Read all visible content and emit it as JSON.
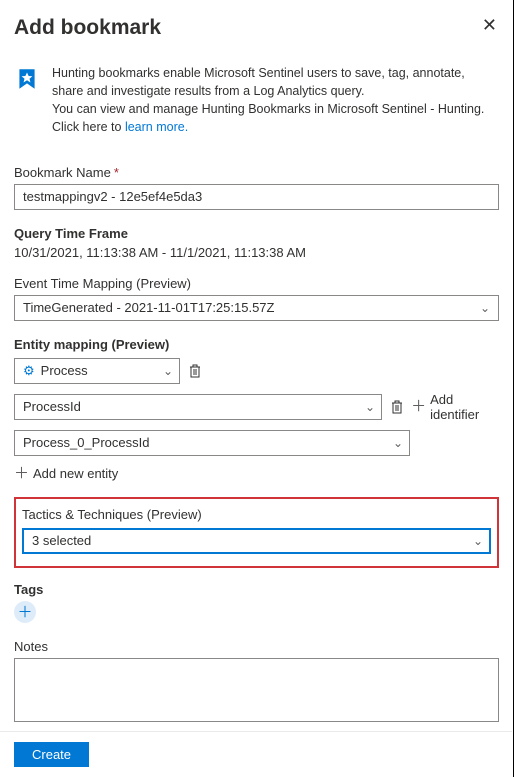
{
  "header": {
    "title": "Add bookmark"
  },
  "info": {
    "line1": "Hunting bookmarks enable Microsoft Sentinel users to save, tag, annotate, share and investigate results from a Log Analytics query.",
    "line2_a": "You can view and manage Hunting Bookmarks in Microsoft Sentinel - Hunting. Click here to ",
    "learn_more": "learn more."
  },
  "bookmark": {
    "label": "Bookmark Name",
    "value": "testmappingv2 - 12e5ef4e5da3"
  },
  "query_time": {
    "label": "Query Time Frame",
    "value": "10/31/2021, 11:13:38 AM - 11/1/2021, 11:13:38 AM"
  },
  "event_time": {
    "label": "Event Time Mapping (Preview)",
    "value": "TimeGenerated - 2021-11-01T17:25:15.57Z"
  },
  "entity": {
    "label": "Entity mapping (Preview)",
    "type_value": "Process",
    "identifier_value": "ProcessId",
    "value_field": "Process_0_ProcessId",
    "add_identifier": "Add identifier",
    "add_entity": "Add new entity"
  },
  "tactics": {
    "label": "Tactics & Techniques (Preview)",
    "value": "3 selected"
  },
  "tags": {
    "label": "Tags"
  },
  "notes": {
    "label": "Notes",
    "value": ""
  },
  "footer": {
    "create": "Create"
  }
}
